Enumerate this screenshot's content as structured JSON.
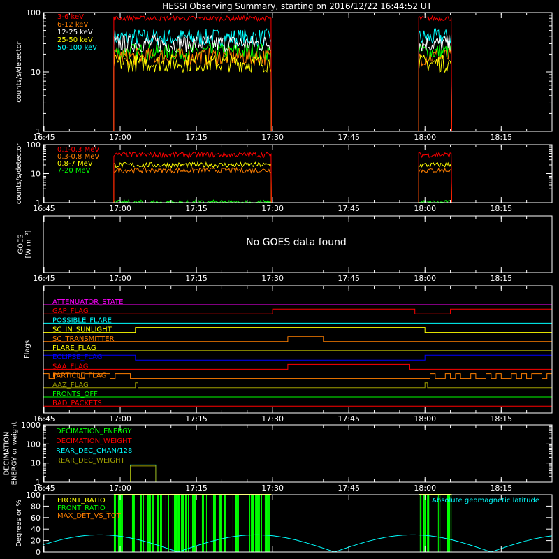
{
  "title": "HESSI Observing Summary, starting on 2016/12/22 16:44:52 UT",
  "time_ticks": [
    "16:45",
    "17:00",
    "17:15",
    "17:30",
    "17:45",
    "18:00",
    "18:15"
  ],
  "chart_data": [
    {
      "id": "lowE",
      "type": "line",
      "ylabel": "counts/s/detector",
      "yscale": "log",
      "ylim": [
        1,
        100
      ],
      "yticks": [
        "1",
        "10",
        "100"
      ],
      "xlim": [
        "16:45",
        "18:25"
      ],
      "active_intervals": [
        [
          "16:58:45",
          "17:29:45"
        ],
        [
          "17:58:45",
          "18:05:15"
        ]
      ],
      "series": [
        {
          "name": "3-6 keV",
          "color": "#ff0000",
          "level": 80
        },
        {
          "name": "6-12 keV",
          "color": "#ff7f00",
          "level": 18
        },
        {
          "name": "12-25 keV",
          "color": "#ffffff",
          "level": 30
        },
        {
          "name": "25-50 keV",
          "color": "#ffff00",
          "level": 14
        },
        {
          "name": "50-100 keV",
          "color": "#00ffff",
          "level": 38
        },
        {
          "name": "",
          "color": "#00ff00",
          "level": 22
        }
      ]
    },
    {
      "id": "highE",
      "type": "line",
      "ylabel": "counts/s/detector",
      "yscale": "log",
      "ylim": [
        1,
        100
      ],
      "yticks": [
        "1",
        "10",
        "100"
      ],
      "active_intervals": [
        [
          "16:58:45",
          "17:29:45"
        ],
        [
          "17:58:45",
          "18:05:15"
        ]
      ],
      "series": [
        {
          "name": "0.1-0.3 MeV",
          "color": "#ff0000",
          "level": 45
        },
        {
          "name": "0.3-0.8 MeV",
          "color": "#ff7f00",
          "level": 13
        },
        {
          "name": "0.8-7 MeV",
          "color": "#ffff00",
          "level": 20
        },
        {
          "name": "7-20 MeV",
          "color": "#00ff00",
          "level": 1
        }
      ]
    },
    {
      "id": "goes",
      "type": "line",
      "ylabel_lines": [
        "GOES",
        "[W m⁻²]"
      ],
      "message": "No GOES data found"
    },
    {
      "id": "flags",
      "type": "line",
      "ylabel": "Flags",
      "flags": [
        {
          "name": "ATTENUATOR_STATE",
          "color": "#ff00ff",
          "changes": []
        },
        {
          "name": "GAP_FLAG",
          "color": "#ff0000",
          "changes": [
            [
              "17:30",
              1
            ],
            [
              "17:58",
              0
            ],
            [
              "18:05",
              1
            ]
          ]
        },
        {
          "name": "POSSIBLE_FLARE",
          "color": "#00ffff",
          "changes": []
        },
        {
          "name": "SC_IN_SUNLIGHT",
          "color": "#ffff00",
          "changes": [
            [
              "17:03",
              1
            ],
            [
              "18:00",
              0
            ]
          ]
        },
        {
          "name": "SC_TRANSMITTER",
          "color": "#ff7f00",
          "changes": [
            [
              "17:33",
              1
            ],
            [
              "17:40",
              0
            ]
          ]
        },
        {
          "name": "FLARE_FLAG",
          "color": "#ffff00",
          "changes": []
        },
        {
          "name": "ECLIPSE_FLAG",
          "color": "#0000ff",
          "start": 1,
          "changes": [
            [
              "17:03",
              0
            ],
            [
              "18:00",
              1
            ]
          ]
        },
        {
          "name": "SAA_FLAG",
          "color": "#ff0000",
          "changes": [
            [
              "17:33",
              1
            ],
            [
              "17:57",
              0
            ]
          ]
        },
        {
          "name": "PARTICLE_FLAG",
          "color": "#ff7f00",
          "start": 1,
          "changes": [
            [
              "16:46",
              0
            ],
            [
              "16:47",
              1
            ],
            [
              "16:52",
              0
            ],
            [
              "16:53",
              1
            ],
            [
              "16:58",
              0
            ],
            [
              "16:59",
              1
            ],
            [
              "17:02",
              0
            ],
            [
              "18:01",
              1
            ],
            [
              "18:02",
              0
            ],
            [
              "18:04",
              1
            ],
            [
              "18:05",
              0
            ],
            [
              "18:06",
              1
            ],
            [
              "18:07",
              0
            ],
            [
              "18:09",
              1
            ],
            [
              "18:10",
              0
            ],
            [
              "18:12",
              1
            ],
            [
              "18:13",
              0
            ],
            [
              "18:14",
              1
            ],
            [
              "18:15",
              0
            ],
            [
              "18:17",
              1
            ],
            [
              "18:18",
              0
            ],
            [
              "18:19",
              1
            ],
            [
              "18:20",
              0
            ],
            [
              "18:21",
              1
            ],
            [
              "18:23",
              0
            ],
            [
              "18:24",
              1
            ]
          ]
        },
        {
          "name": "AAZ_FLAG",
          "color": "#a0a000",
          "changes": [
            [
              "17:03",
              1
            ],
            [
              "17:03:30",
              0
            ],
            [
              "18:00",
              1
            ],
            [
              "18:00:30",
              0
            ]
          ]
        },
        {
          "name": "FRONTS_OFF",
          "color": "#00ff00",
          "changes": []
        },
        {
          "name": "BAD_PACKETS",
          "color": "#ff0000",
          "changes": []
        }
      ]
    },
    {
      "id": "decim",
      "type": "line",
      "ylabel_lines": [
        "DECIMATION",
        "ENERGY or weight"
      ],
      "yscale": "log",
      "ylim": [
        1,
        1000
      ],
      "yticks": [
        "1",
        "10",
        "100",
        "1000"
      ],
      "series": [
        {
          "name": "DECIMATION_ENERGY",
          "color": "#00ff00"
        },
        {
          "name": "DECIMATION_WEIGHT",
          "color": "#ff0000"
        },
        {
          "name": "REAR_DEC_CHAN/128",
          "color": "#00ffff",
          "box": [
            "17:02",
            "17:07",
            8
          ]
        },
        {
          "name": "REAR_DEC_WEIGHT",
          "color": "#a0a000",
          "box": [
            "17:02",
            "17:07",
            7
          ]
        }
      ]
    },
    {
      "id": "ratio",
      "type": "line",
      "ylabel": "Degrees or %",
      "ylim": [
        0,
        100
      ],
      "yticks": [
        "0",
        "20",
        "40",
        "60",
        "80",
        "100"
      ],
      "series": [
        {
          "name": "FRONT_RATIO",
          "color": "#ffff00"
        },
        {
          "name": "FRONT_RATIO_",
          "color": "#00ff00"
        },
        {
          "name": "MAX_DET_VS_TOT",
          "color": "#ff7f00"
        }
      ],
      "annotation": {
        "text": "Absolute geomagnetic latitude",
        "color": "#00ffff"
      }
    }
  ]
}
